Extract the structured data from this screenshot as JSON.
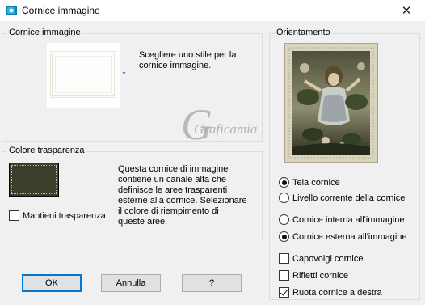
{
  "window": {
    "title": "Cornice immagine",
    "close_symbol": "✕"
  },
  "frame_group": {
    "label": "Cornice immagine",
    "description_lines": [
      "Scegliere uno stile per la",
      "cornice immagine."
    ]
  },
  "transparency_group": {
    "label": "Colore trasparenza",
    "swatch_color": "#3b3e2a",
    "keep_transparency_label": "Mantieni trasparenza",
    "keep_transparency_checked": false,
    "description_lines": [
      "Questa cornice di immagine",
      "contiene un canale alfa che",
      "definisce le aree trasparenti",
      "esterne alla cornice. Selezionare",
      "il colore di riempimento di",
      "queste aree."
    ]
  },
  "orientation_group": {
    "label": "Orientamento",
    "options": {
      "tela_cornice": {
        "label": "Tela cornice",
        "checked": true
      },
      "livello_corrente": {
        "label": "Livello corrente della cornice",
        "checked": false
      },
      "cornice_interna": {
        "label": "Cornice interna all'immagine",
        "checked": false
      },
      "cornice_esterna": {
        "label": "Cornice esterna all'immagine",
        "checked": true
      }
    },
    "checkboxes": {
      "capovolgi": {
        "label": "Capovolgi cornice",
        "checked": false
      },
      "rifletti": {
        "label": "Rifletti cornice",
        "checked": false
      },
      "ruota": {
        "label": "Ruota cornice a destra",
        "checked": true
      }
    }
  },
  "buttons": {
    "ok": "OK",
    "cancel": "Annulla",
    "help": "?"
  },
  "watermark": {
    "text": "Graficamia"
  },
  "colors": {
    "accent": "#0078d7",
    "app_icon": "#0a7fb5"
  }
}
